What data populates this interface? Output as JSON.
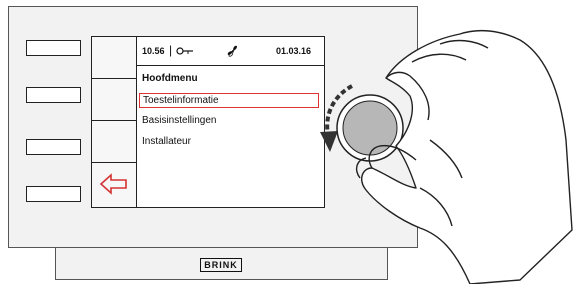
{
  "status_bar": {
    "time": "10.56",
    "date": "01.03.16",
    "key_icon": "key-icon",
    "fan_icon": "fan-icon"
  },
  "menu": {
    "title": "Hoofdmenu",
    "items": [
      {
        "label": "Toestelinformatie",
        "selected": true
      },
      {
        "label": "Basisinstellingen",
        "selected": false
      },
      {
        "label": "Installateur",
        "selected": false
      }
    ]
  },
  "softkeys": {
    "back_icon": "back-arrow-icon",
    "back_color": "#d33333"
  },
  "brand": {
    "logo": "BRINK"
  },
  "colors": {
    "selection": "#dd3333",
    "panel": "#f2f2f2",
    "knob": "#b7b7b7"
  }
}
